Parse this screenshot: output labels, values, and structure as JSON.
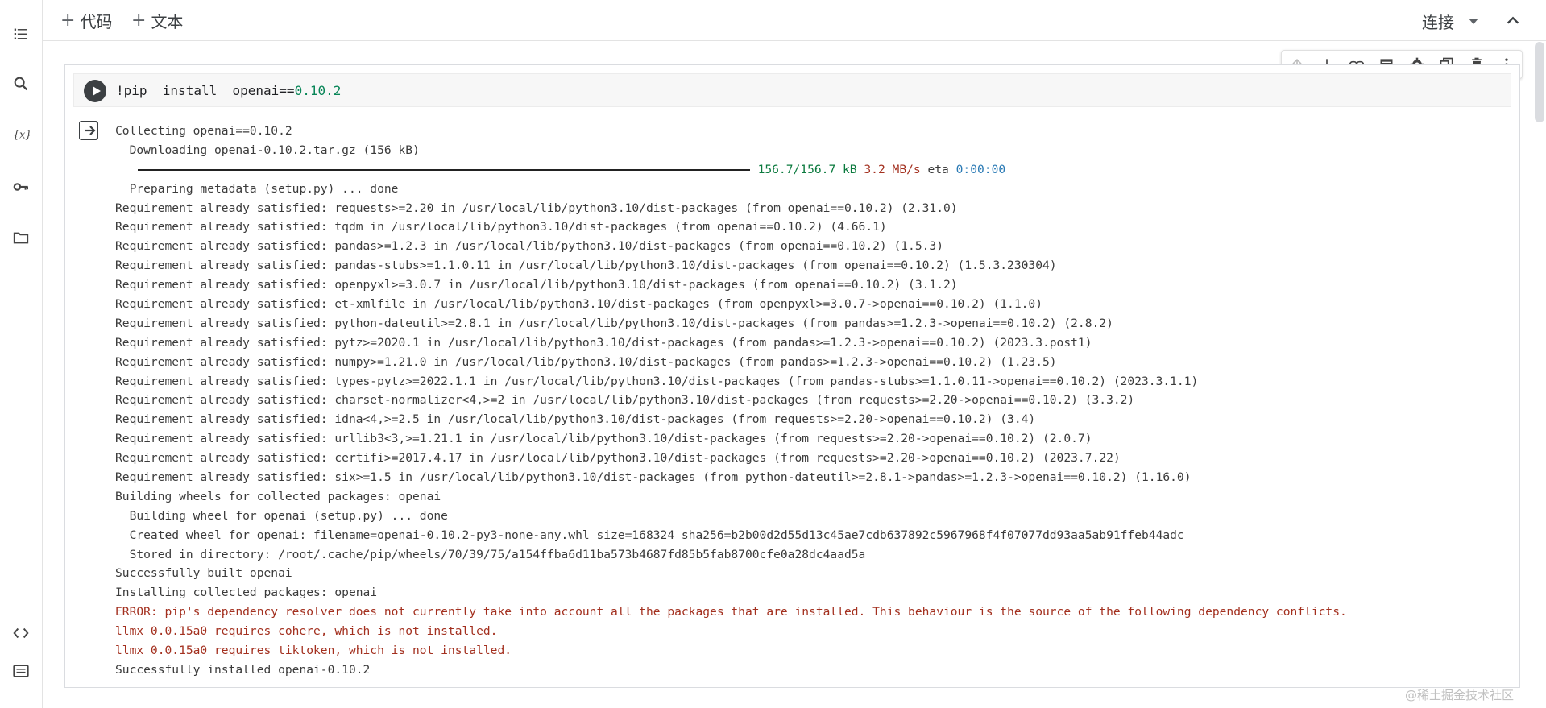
{
  "toolbar": {
    "add_code_label": "代码",
    "add_text_label": "文本",
    "connect_label": "连接"
  },
  "cell": {
    "code": "!pip  install  openai==0.10.2",
    "code_prefix": "!pip  install  openai==",
    "code_version": "0.10.2",
    "output_lines": [
      {
        "text": "Collecting openai==0.10.2",
        "type": "normal"
      },
      {
        "text": "  Downloading openai-0.10.2.tar.gz (156 kB)",
        "type": "normal"
      },
      {
        "text": "",
        "type": "progress"
      },
      {
        "text": "  Preparing metadata (setup.py) ... done",
        "type": "normal"
      },
      {
        "text": "Requirement already satisfied: requests>=2.20 in /usr/local/lib/python3.10/dist-packages (from openai==0.10.2) (2.31.0)",
        "type": "normal"
      },
      {
        "text": "Requirement already satisfied: tqdm in /usr/local/lib/python3.10/dist-packages (from openai==0.10.2) (4.66.1)",
        "type": "normal"
      },
      {
        "text": "Requirement already satisfied: pandas>=1.2.3 in /usr/local/lib/python3.10/dist-packages (from openai==0.10.2) (1.5.3)",
        "type": "normal"
      },
      {
        "text": "Requirement already satisfied: pandas-stubs>=1.1.0.11 in /usr/local/lib/python3.10/dist-packages (from openai==0.10.2) (1.5.3.230304)",
        "type": "normal"
      },
      {
        "text": "Requirement already satisfied: openpyxl>=3.0.7 in /usr/local/lib/python3.10/dist-packages (from openai==0.10.2) (3.1.2)",
        "type": "normal"
      },
      {
        "text": "Requirement already satisfied: et-xmlfile in /usr/local/lib/python3.10/dist-packages (from openpyxl>=3.0.7->openai==0.10.2) (1.1.0)",
        "type": "normal"
      },
      {
        "text": "Requirement already satisfied: python-dateutil>=2.8.1 in /usr/local/lib/python3.10/dist-packages (from pandas>=1.2.3->openai==0.10.2) (2.8.2)",
        "type": "normal"
      },
      {
        "text": "Requirement already satisfied: pytz>=2020.1 in /usr/local/lib/python3.10/dist-packages (from pandas>=1.2.3->openai==0.10.2) (2023.3.post1)",
        "type": "normal"
      },
      {
        "text": "Requirement already satisfied: numpy>=1.21.0 in /usr/local/lib/python3.10/dist-packages (from pandas>=1.2.3->openai==0.10.2) (1.23.5)",
        "type": "normal"
      },
      {
        "text": "Requirement already satisfied: types-pytz>=2022.1.1 in /usr/local/lib/python3.10/dist-packages (from pandas-stubs>=1.1.0.11->openai==0.10.2) (2023.3.1.1)",
        "type": "normal"
      },
      {
        "text": "Requirement already satisfied: charset-normalizer<4,>=2 in /usr/local/lib/python3.10/dist-packages (from requests>=2.20->openai==0.10.2) (3.3.2)",
        "type": "normal"
      },
      {
        "text": "Requirement already satisfied: idna<4,>=2.5 in /usr/local/lib/python3.10/dist-packages (from requests>=2.20->openai==0.10.2) (3.4)",
        "type": "normal"
      },
      {
        "text": "Requirement already satisfied: urllib3<3,>=1.21.1 in /usr/local/lib/python3.10/dist-packages (from requests>=2.20->openai==0.10.2) (2.0.7)",
        "type": "normal"
      },
      {
        "text": "Requirement already satisfied: certifi>=2017.4.17 in /usr/local/lib/python3.10/dist-packages (from requests>=2.20->openai==0.10.2) (2023.7.22)",
        "type": "normal"
      },
      {
        "text": "Requirement already satisfied: six>=1.5 in /usr/local/lib/python3.10/dist-packages (from python-dateutil>=2.8.1->pandas>=1.2.3->openai==0.10.2) (1.16.0)",
        "type": "normal"
      },
      {
        "text": "Building wheels for collected packages: openai",
        "type": "normal"
      },
      {
        "text": "  Building wheel for openai (setup.py) ... done",
        "type": "normal"
      },
      {
        "text": "  Created wheel for openai: filename=openai-0.10.2-py3-none-any.whl size=168324 sha256=b2b00d2d55d13c45ae7cdb637892c5967968f4f07077dd93aa5ab91ffeb44adc",
        "type": "normal"
      },
      {
        "text": "  Stored in directory: /root/.cache/pip/wheels/70/39/75/a154ffba6d11ba573b4687fd85b5fab8700cfe0a28dc4aad5a",
        "type": "normal"
      },
      {
        "text": "Successfully built openai",
        "type": "normal"
      },
      {
        "text": "Installing collected packages: openai",
        "type": "normal"
      },
      {
        "text": "ERROR: pip's dependency resolver does not currently take into account all the packages that are installed. This behaviour is the source of the following dependency conflicts.",
        "type": "err"
      },
      {
        "text": "llmx 0.0.15a0 requires cohere, which is not installed.",
        "type": "err"
      },
      {
        "text": "llmx 0.0.15a0 requires tiktoken, which is not installed.",
        "type": "err"
      },
      {
        "text": "Successfully installed openai-0.10.2",
        "type": "normal"
      }
    ],
    "progress": {
      "size": "156.7/156.7 kB",
      "speed": "3.2 MB/s",
      "eta_label": "eta",
      "eta": "0:00:00",
      "fraction": 1.0
    }
  },
  "watermark": "@稀土掘金技术社区",
  "icons": {
    "sidebar": [
      "toc-icon",
      "search-icon",
      "variables-icon",
      "key-icon",
      "folder-icon",
      "code-snippets-icon",
      "terminal-icon"
    ],
    "cell_toolbar": [
      "arrow-up-icon",
      "arrow-down-icon",
      "link-icon",
      "comment-icon",
      "gear-icon",
      "mirror-cell-icon",
      "delete-icon",
      "more-vert-icon"
    ]
  }
}
